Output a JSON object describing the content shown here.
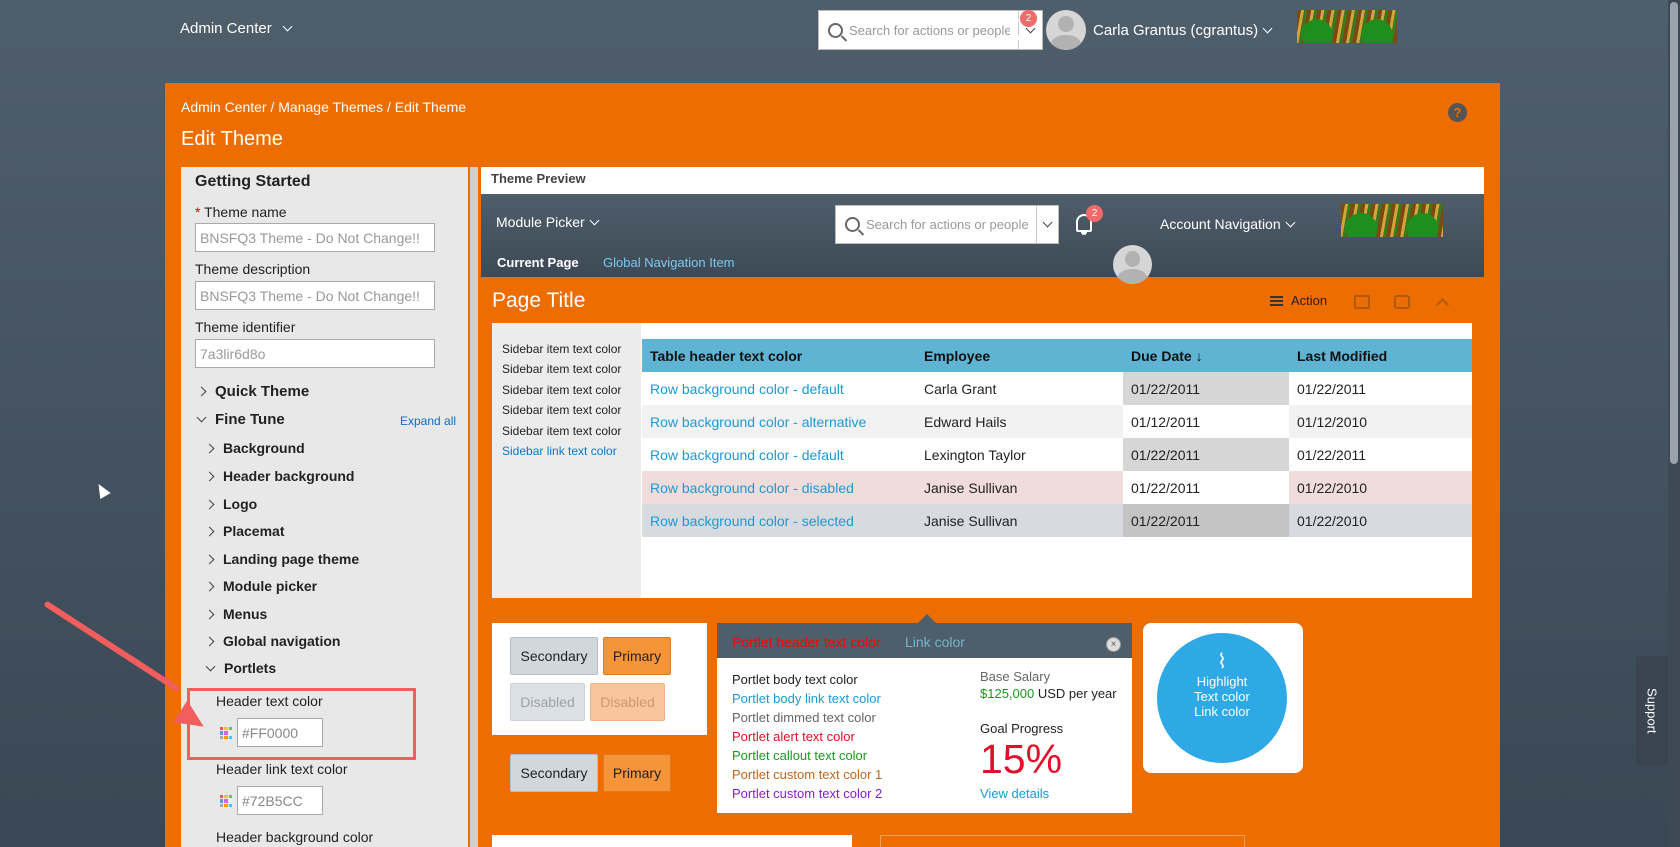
{
  "topbar": {
    "module": "Admin Center",
    "search_placeholder": "Search for actions or people",
    "notifications": "2",
    "user": "Carla Grantus (cgrantus)"
  },
  "breadcrumb": "Admin Center / Manage Themes / Edit Theme",
  "page_title": "Edit Theme",
  "help": "?",
  "left_panel": {
    "heading": "Getting Started",
    "theme_name_label": "Theme name",
    "theme_name_value": "BNSFQ3 Theme - Do Not Change!!",
    "theme_desc_label": "Theme description",
    "theme_desc_value": "BNSFQ3 Theme - Do Not Change!!",
    "theme_id_label": "Theme identifier",
    "theme_id_value": "7a3lir6d8o",
    "quick_theme": "Quick Theme",
    "fine_tune": "Fine Tune",
    "expand_all": "Expand all",
    "items": [
      "Background",
      "Header background",
      "Logo",
      "Placemat",
      "Landing page theme",
      "Module picker",
      "Menus",
      "Global navigation"
    ],
    "portlets": "Portlets",
    "header_text_color_label": "Header text color",
    "header_text_color_value": "#FF0000",
    "header_link_color_label": "Header link text color",
    "header_link_color_value": "#72B5CC",
    "header_bg_color_label": "Header background color"
  },
  "preview": {
    "label": "Theme Preview",
    "module": "Module Picker",
    "search_placeholder": "Search for actions or people",
    "notifications": "2",
    "account": "Account Navigation",
    "current_page": "Current Page",
    "global_nav": "Global Navigation Item",
    "page_title": "Page Title",
    "action": "Action",
    "sidebar_items": [
      "Sidebar item text color",
      "Sidebar item text color",
      "Sidebar item text color",
      "Sidebar item text color",
      "Sidebar item text color"
    ],
    "sidebar_link": "Sidebar link text color",
    "table": {
      "headers": [
        "Table header text color",
        "Employee",
        "Due Date",
        "Last Modified"
      ],
      "rows": [
        [
          "Row background color - default",
          "Carla Grant",
          "01/22/2011",
          "01/22/2011"
        ],
        [
          "Row background color - alternative",
          "Edward Hails",
          "01/12/2011",
          "01/12/2010"
        ],
        [
          "Row background color - default",
          "Lexington Taylor",
          "01/22/2011",
          "01/22/2011"
        ],
        [
          "Row background color - disabled",
          "Janise Sullivan",
          "01/22/2011",
          "01/22/2010"
        ],
        [
          "Row background color - selected",
          "Janise Sullivan",
          "01/22/2011",
          "01/22/2010"
        ]
      ]
    },
    "buttons": {
      "secondary": "Secondary",
      "primary": "Primary",
      "disabled": "Disabled"
    },
    "portlet": {
      "header_text": "Portlet header text color",
      "header_link": "Link color",
      "close": "×",
      "lines": [
        {
          "text": "Portlet body text color",
          "color": "#222222"
        },
        {
          "text": "Portlet body link text color",
          "color": "#1a9ad6"
        },
        {
          "text": "Portlet dimmed text color",
          "color": "#666666"
        },
        {
          "text": "Portlet alert text color",
          "color": "#e0102a"
        },
        {
          "text": "Portlet callout text color",
          "color": "#1a9a1a"
        },
        {
          "text": "Portlet custom text color 1",
          "color": "#c0661c"
        },
        {
          "text": "Portlet custom text color 2",
          "color": "#8a1cc8"
        }
      ],
      "base_salary_label": "Base Salary",
      "salary_amount": "$125,000",
      "salary_suffix": "USD per year",
      "goal_label": "Goal Progress",
      "goal_value": "15%",
      "view_details": "View details"
    },
    "highlight": {
      "line1": "Highlight",
      "line2": "Text color",
      "line3": "Link color"
    }
  },
  "support": "Support",
  "colors": {
    "orange": "#ee6d00",
    "header": "#4f5e6b",
    "table_header": "#5fb3d3",
    "link": "#1a9ad6",
    "highlight": "#2fa8e6",
    "annotation": "#f25d5d"
  }
}
